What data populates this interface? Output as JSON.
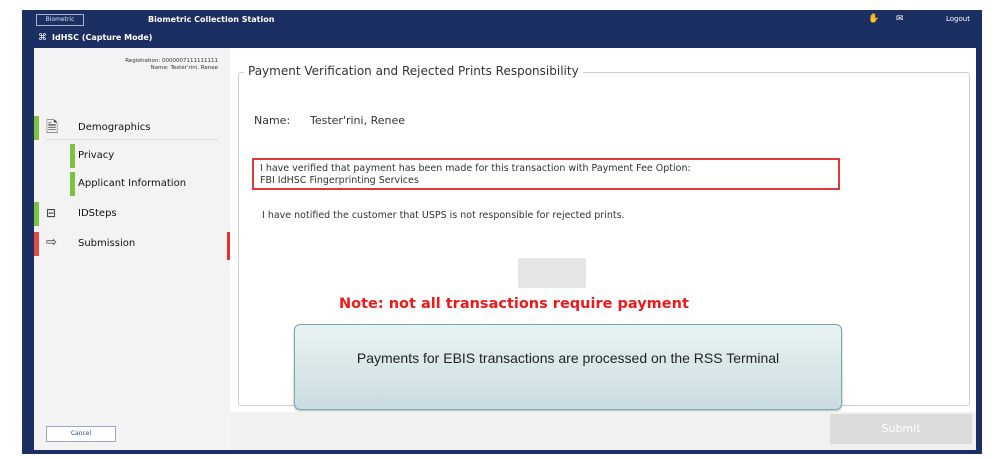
{
  "header": {
    "logo_text": "Biometric",
    "app_title": "Biometric Collection Station",
    "mode": "IdHSC (Capture Mode)",
    "user": "Logout",
    "icons": [
      "fingerprint-icon",
      "mail-icon"
    ]
  },
  "sidebar": {
    "pid_line1": "Registration: 0000007111111111",
    "pid_line2": "Name: Tester'rini, Renee",
    "items": [
      {
        "label": "Demographics",
        "icon": "document-icon",
        "status": "complete"
      },
      {
        "label": "Privacy",
        "status": "complete"
      },
      {
        "label": "Applicant Information",
        "status": "complete"
      },
      {
        "label": "IDSteps",
        "icon": "scanner-icon",
        "status": "complete"
      },
      {
        "label": "Submission",
        "icon": "export-icon",
        "status": "active"
      }
    ],
    "cancel_label": "Cancel"
  },
  "main": {
    "section_title": "Payment Verification and Rejected Prints Responsibility",
    "name_label": "Name:",
    "name_value": "Tester'rini, Renee",
    "verify_line1": "I have verified that payment has been made for this transaction with Payment Fee Option:",
    "verify_line2": "FBI IdHSC Fingerprinting Services",
    "notified_text": "I have notified the customer that USPS is not responsible for rejected prints.",
    "note": "Note: not all transactions require payment",
    "callout": "Payments for EBIS transactions are processed on the RSS Terminal"
  },
  "footer": {
    "submit_label": "Submit"
  },
  "colors": {
    "header_bg": "#1c2f63",
    "complete_green": "#7cc243",
    "active_red": "#e53030",
    "note_red": "#f01818"
  }
}
